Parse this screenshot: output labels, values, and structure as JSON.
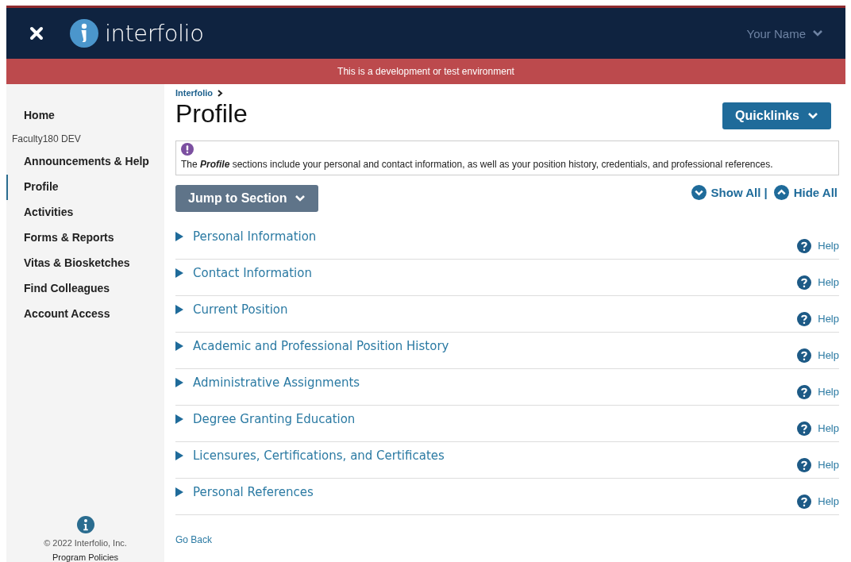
{
  "header": {
    "logo_text": "interfolio",
    "user_menu": "Your Name"
  },
  "banner": "This is a development or test environment",
  "sidebar": {
    "items": [
      {
        "kind": "link",
        "label": "Home",
        "selected": false
      },
      {
        "kind": "heading",
        "label": "Faculty180 DEV"
      },
      {
        "kind": "link",
        "label": "Announcements & Help",
        "selected": false
      },
      {
        "kind": "link",
        "label": "Profile",
        "selected": true
      },
      {
        "kind": "link",
        "label": "Activities",
        "selected": false
      },
      {
        "kind": "link",
        "label": "Forms & Reports",
        "selected": false
      },
      {
        "kind": "link",
        "label": "Vitas & Biosketches",
        "selected": false
      },
      {
        "kind": "link",
        "label": "Find Colleagues",
        "selected": false
      },
      {
        "kind": "link",
        "label": "Account Access",
        "selected": false
      }
    ],
    "footer": {
      "copyright": "© 2022 Interfolio, Inc.",
      "policies": "Program Policies"
    }
  },
  "breadcrumb": [
    "Interfolio"
  ],
  "page_title": "Profile",
  "quicklinks": "Quicklinks",
  "notice": "The **Profile** sections include your personal and contact information, as well as your position history, credentials, and professional references.",
  "jump_button": "Jump to Section",
  "show_all": "Show All |",
  "hide_all": "Hide All",
  "sections": [
    {
      "title": "Personal Information",
      "expanded": false,
      "help": "Help"
    },
    {
      "title": "Contact Information",
      "expanded": false,
      "help": "Help"
    },
    {
      "title": "Current Position",
      "expanded": false,
      "help": "Help"
    },
    {
      "title": "Academic and Professional Position History",
      "expanded": false,
      "help": "Help"
    },
    {
      "title": "Administrative Assignments",
      "expanded": false,
      "help": "Help"
    },
    {
      "title": "Degree Granting Education",
      "expanded": false,
      "help": "Help"
    },
    {
      "title": "Licensures, Certifications, and Certificates",
      "expanded": false,
      "help": "Help"
    },
    {
      "title": "Personal References",
      "expanded": false,
      "help": "Help"
    }
  ],
  "back_link": "Go Back"
}
